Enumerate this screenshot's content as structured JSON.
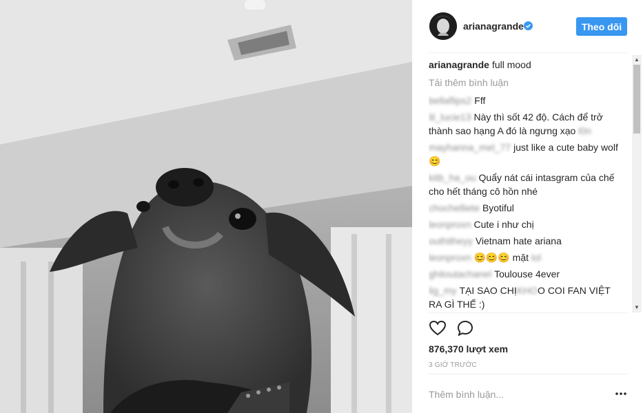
{
  "header": {
    "username": "arianagrande",
    "follow_label": "Theo dõi"
  },
  "caption": {
    "username": "arianagrande",
    "text": "full mood"
  },
  "load_more": "Tải thêm bình luận",
  "comments": [
    {
      "user": "bellaflips2",
      "text": "Fff"
    },
    {
      "user": "lil_lucie13",
      "text": "Này thì sốt 42 độ. Cách để trở thành sao hạng A đó là ngưng xạo",
      "trailing": "l0n"
    },
    {
      "user": "mayhanna_mel_77",
      "text": "just like a cute baby wolf😊"
    },
    {
      "user": "kitb_ha_ou",
      "text": "Quẩy nát cái intasgram của chế cho hết tháng cô hồn nhé"
    },
    {
      "user": "chochelliete",
      "text": "Byotiful"
    },
    {
      "user": "leonproxn",
      "text": "Cute i như chị"
    },
    {
      "user": "outhitheyy",
      "text": "Vietnam hate ariana"
    },
    {
      "user": "leonproxn",
      "text": "😊😊😊 mặt",
      "trailing": "lol"
    },
    {
      "user": "ghitoutachanel",
      "text": "Toulouse 4ever"
    },
    {
      "user": "lig_my",
      "text": "TẠI SAO CHỊ",
      "masked": "KHO",
      "text2": "O COI FAN VIỆT RA GÌ THẾ :)"
    }
  ],
  "stats": {
    "views": "876,370 lượt xem",
    "time": "3 GIỜ TRƯỚC"
  },
  "add_comment_placeholder": "Thêm bình luận...",
  "icons": {
    "like": "heart-outline-icon",
    "comment": "speech-bubble-icon",
    "more": "three-dots-icon",
    "verified": "verified-badge-icon"
  },
  "colors": {
    "accent": "#3897f0",
    "text": "#262626",
    "muted": "#999999"
  }
}
